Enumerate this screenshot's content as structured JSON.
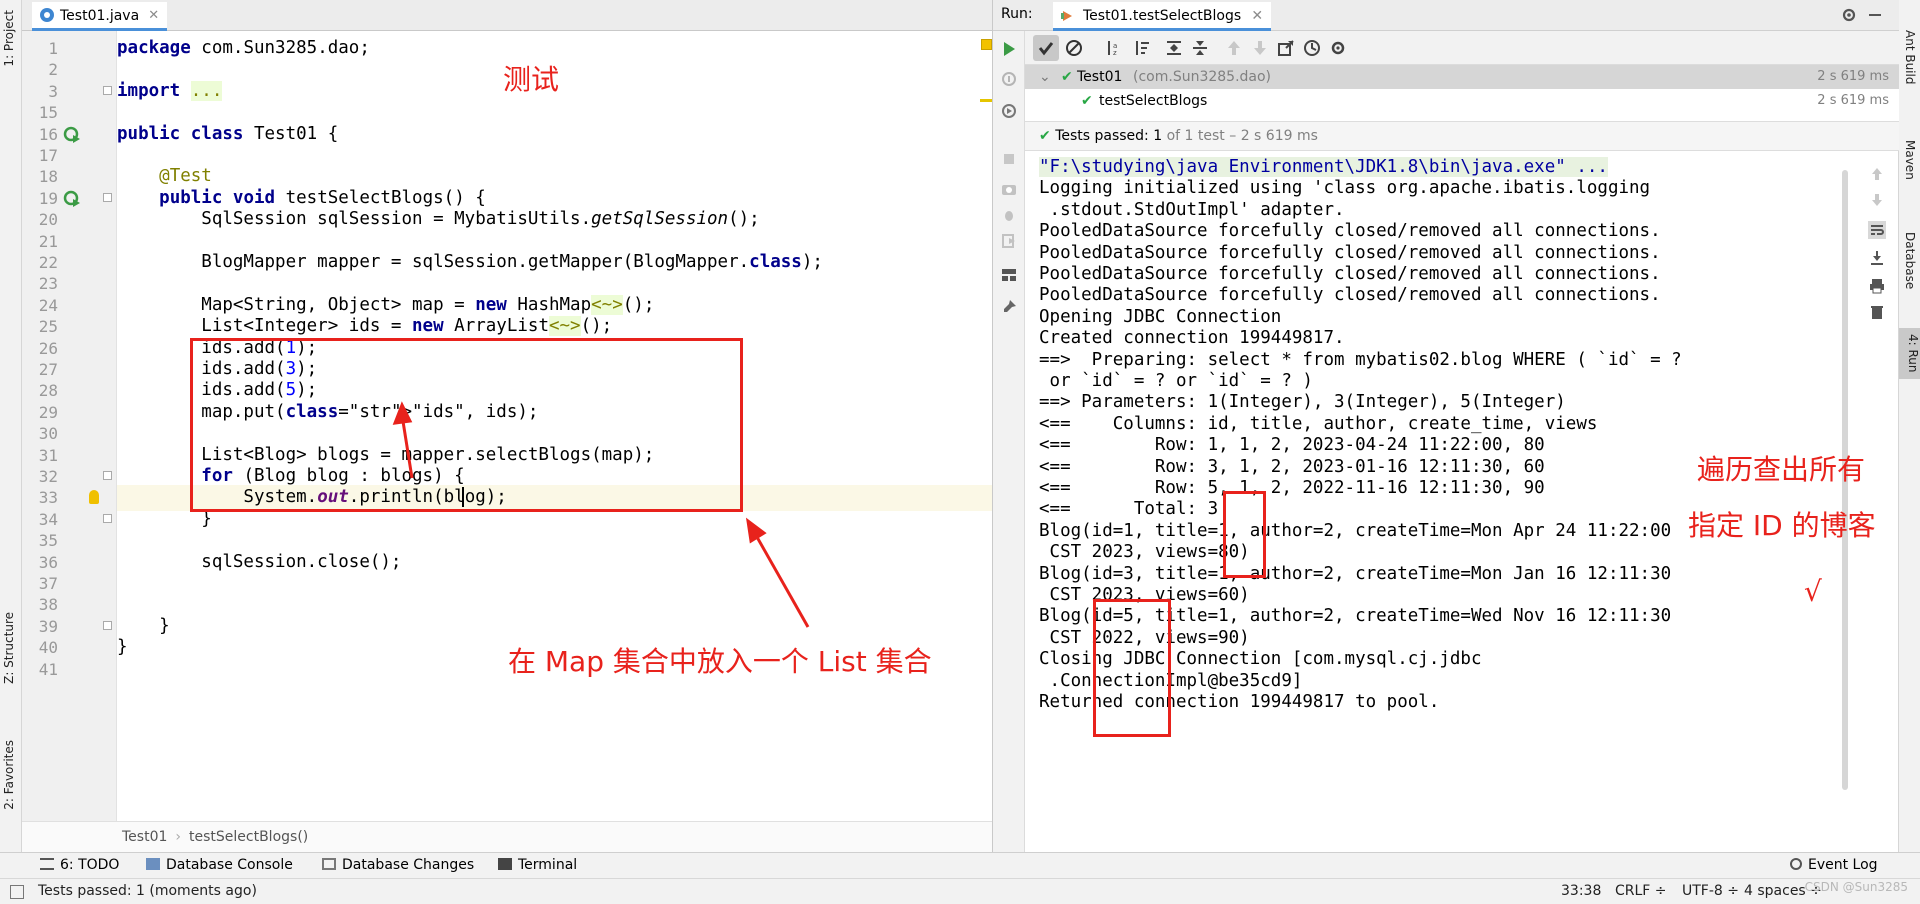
{
  "left_strip": {
    "project": "1: Project",
    "structure": "Z: Structure",
    "favorites": "2: Favorites"
  },
  "right_strip": {
    "ant": "Ant Build",
    "maven": "Maven",
    "database": "Database",
    "run": "4: Run"
  },
  "editor": {
    "tab_label": "Test01.java",
    "lines": [
      {
        "n": "1",
        "text": "package com.Sun3285.dao;"
      },
      {
        "n": "2",
        "text": ""
      },
      {
        "n": "3",
        "text": "import ..."
      },
      {
        "n": "15",
        "text": ""
      },
      {
        "n": "16",
        "text": "public class Test01 {"
      },
      {
        "n": "17",
        "text": ""
      },
      {
        "n": "18",
        "text": "    @Test"
      },
      {
        "n": "19",
        "text": "    public void testSelectBlogs() {"
      },
      {
        "n": "20",
        "text": "        SqlSession sqlSession = MybatisUtils.getSqlSession();"
      },
      {
        "n": "21",
        "text": ""
      },
      {
        "n": "22",
        "text": "        BlogMapper mapper = sqlSession.getMapper(BlogMapper.class);"
      },
      {
        "n": "23",
        "text": ""
      },
      {
        "n": "24",
        "text": "        Map<String, Object> map = new HashMap<~>();"
      },
      {
        "n": "25",
        "text": "        List<Integer> ids = new ArrayList<~>();"
      },
      {
        "n": "26",
        "text": "        ids.add(1);"
      },
      {
        "n": "27",
        "text": "        ids.add(3);"
      },
      {
        "n": "28",
        "text": "        ids.add(5);"
      },
      {
        "n": "29",
        "text": "        map.put(\"ids\", ids);"
      },
      {
        "n": "30",
        "text": ""
      },
      {
        "n": "31",
        "text": "        List<Blog> blogs = mapper.selectBlogs(map);"
      },
      {
        "n": "32",
        "text": "        for (Blog blog : blogs) {"
      },
      {
        "n": "33",
        "text": "            System.out.println(blog);"
      },
      {
        "n": "34",
        "text": "        }"
      },
      {
        "n": "35",
        "text": ""
      },
      {
        "n": "36",
        "text": "        sqlSession.close();"
      },
      {
        "n": "37",
        "text": ""
      },
      {
        "n": "38",
        "text": ""
      },
      {
        "n": "39",
        "text": "    }"
      },
      {
        "n": "40",
        "text": "}"
      },
      {
        "n": "41",
        "text": ""
      }
    ],
    "breadcrumb": [
      "Test01",
      "testSelectBlogs()"
    ]
  },
  "annotations": {
    "test_label": "测试",
    "map_note": "在 Map 集合中放入一个 List 集合",
    "result_note_1": "遍历查出所有",
    "result_note_2": "指定 ID 的博客",
    "check_mark": "√"
  },
  "run": {
    "label": "Run:",
    "tab": "Test01.testSelectBlogs",
    "tree": [
      {
        "name": "Test01",
        "detail": "(com.Sun3285.dao)",
        "time": "2 s 619 ms"
      },
      {
        "name": "testSelectBlogs",
        "detail": "",
        "time": "2 s 619 ms"
      }
    ],
    "status_bold": "Tests passed:",
    "status_count": "1",
    "status_rest": "of 1 test – 2 s 619 ms",
    "console": [
      "\"F:\\studying\\java Environment\\JDK1.8\\bin\\java.exe\" ...",
      "Logging initialized using 'class org.apache.ibatis.logging",
      " .stdout.StdOutImpl' adapter.",
      "PooledDataSource forcefully closed/removed all connections.",
      "PooledDataSource forcefully closed/removed all connections.",
      "PooledDataSource forcefully closed/removed all connections.",
      "PooledDataSource forcefully closed/removed all connections.",
      "Opening JDBC Connection",
      "Created connection 199449817.",
      "==>  Preparing: select * from mybatis02.blog WHERE ( `id` = ?",
      " or `id` = ? or `id` = ? )",
      "==> Parameters: 1(Integer), 3(Integer), 5(Integer)",
      "<==    Columns: id, title, author, create_time, views",
      "<==        Row: 1, 1, 2, 2023-04-24 11:22:00, 80",
      "<==        Row: 3, 1, 2, 2023-01-16 12:11:30, 60",
      "<==        Row: 5, 1, 2, 2022-11-16 12:11:30, 90",
      "<==      Total: 3",
      "Blog(id=1, title=1, author=2, createTime=Mon Apr 24 11:22:00",
      " CST 2023, views=80)",
      "Blog(id=3, title=1, author=2, createTime=Mon Jan 16 12:11:30",
      " CST 2023, views=60)",
      "Blog(id=5, title=1, author=2, createTime=Wed Nov 16 12:11:30",
      " CST 2022, views=90)",
      "Closing JDBC Connection [com.mysql.cj.jdbc",
      " .ConnectionImpl@be35cd9]",
      "Returned connection 199449817 to pool."
    ]
  },
  "tool_tabs": {
    "todo": "6: TODO",
    "db_console": "Database Console",
    "db_changes": "Database Changes",
    "terminal": "Terminal",
    "event_log": "Event Log"
  },
  "status": {
    "message": "Tests passed: 1 (moments ago)",
    "position": "33:38",
    "line_sep": "CRLF ÷",
    "encoding": "UTF-8 ÷",
    "indent": "4 spaces ÷"
  },
  "watermark": "CSDN @Sun3285",
  "colors": {
    "annotation_red": "#e8221c",
    "pass_green": "#28a745",
    "tab_underline": "#4a90d9"
  }
}
